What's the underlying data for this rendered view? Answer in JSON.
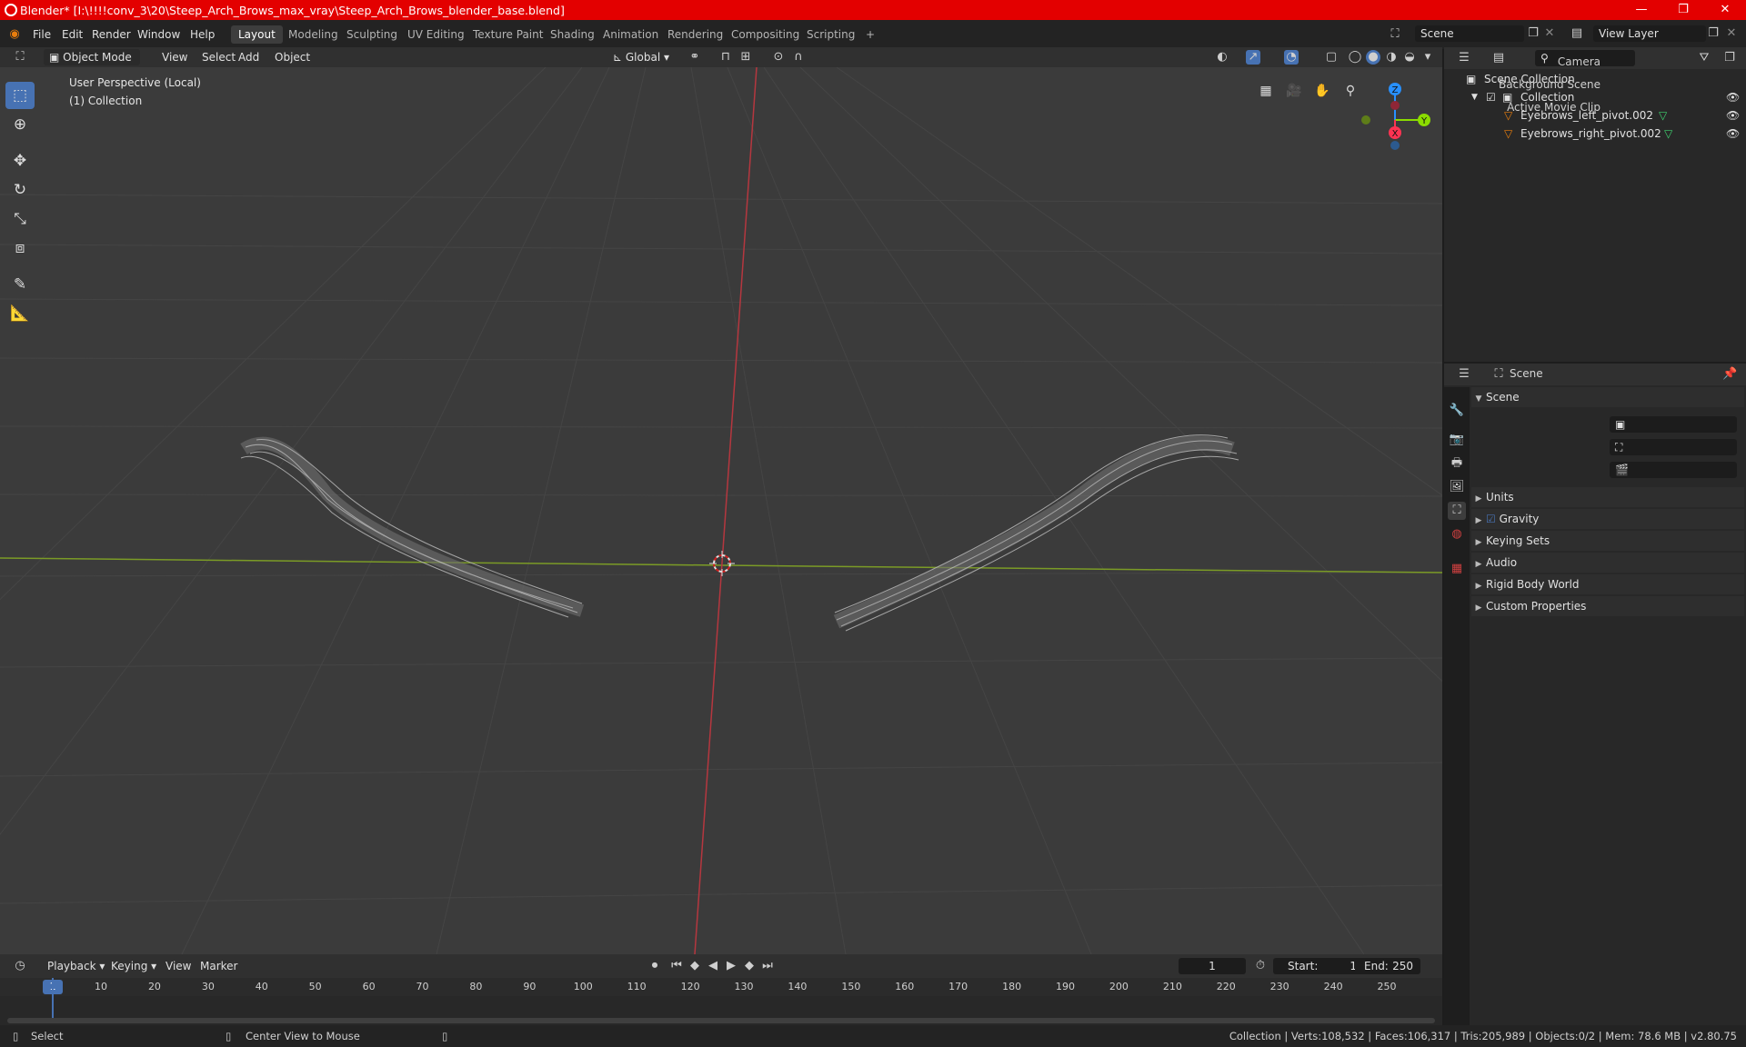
{
  "title_bar": {
    "title": "Blender* [I:\\!!!!conv_3\\20\\Steep_Arch_Brows_max_vray\\Steep_Arch_Brows_blender_base.blend]",
    "minimize": "—",
    "maximize": "❐",
    "close": "✕"
  },
  "menu": {
    "file": "File",
    "edit": "Edit",
    "render": "Render",
    "window": "Window",
    "help": "Help"
  },
  "workspaces": [
    "Layout",
    "Modeling",
    "Sculpting",
    "UV Editing",
    "Texture Paint",
    "Shading",
    "Animation",
    "Rendering",
    "Compositing",
    "Scripting"
  ],
  "workspace_add": "+",
  "scene_field": "Scene",
  "view_layer_field": "View Layer",
  "viewport_header": {
    "mode": "Object Mode",
    "view": "View",
    "select": "Select",
    "add": "Add",
    "object": "Object",
    "transform": "Global"
  },
  "viewport": {
    "perspective": "User Perspective (Local)",
    "collection": "(1) Collection"
  },
  "gizmo": {
    "z": "Z",
    "y": "Y",
    "x": "X"
  },
  "outliner": {
    "root": "Scene Collection",
    "collection": "Collection",
    "objects": [
      "Eyebrows_left_pivot.002",
      "Eyebrows_right_pivot.002"
    ]
  },
  "properties": {
    "header": "Scene",
    "section": "Scene",
    "camera_label": "Camera",
    "background_label": "Background Scene",
    "movie_clip_label": "Active Movie Clip",
    "sections": [
      "Units",
      "Gravity",
      "Keying Sets",
      "Audio",
      "Rigid Body World",
      "Custom Properties"
    ]
  },
  "timeline": {
    "playback": "Playback",
    "keying": "Keying",
    "view": "View",
    "marker": "Marker",
    "current_frame": "1",
    "start_label": "Start:",
    "start": "1",
    "end_label": "End:",
    "end": "250",
    "ticks": [
      "1",
      "10",
      "20",
      "30",
      "40",
      "50",
      "60",
      "70",
      "80",
      "90",
      "100",
      "110",
      "120",
      "130",
      "140",
      "150",
      "160",
      "170",
      "180",
      "190",
      "200",
      "210",
      "220",
      "230",
      "240",
      "250"
    ]
  },
  "status": {
    "select": "Select",
    "center": "Center View to Mouse",
    "stats": "Collection | Verts:108,532 | Faces:106,317 | Tris:205,989 | Objects:0/2 | Mem: 78.6 MB | v2.80.75"
  },
  "colors": {
    "title_bar": "#e30000",
    "active": "#4772b3",
    "x_axis": "#ff3352",
    "y_axis": "#8bdc00",
    "z_axis": "#2890ff"
  }
}
